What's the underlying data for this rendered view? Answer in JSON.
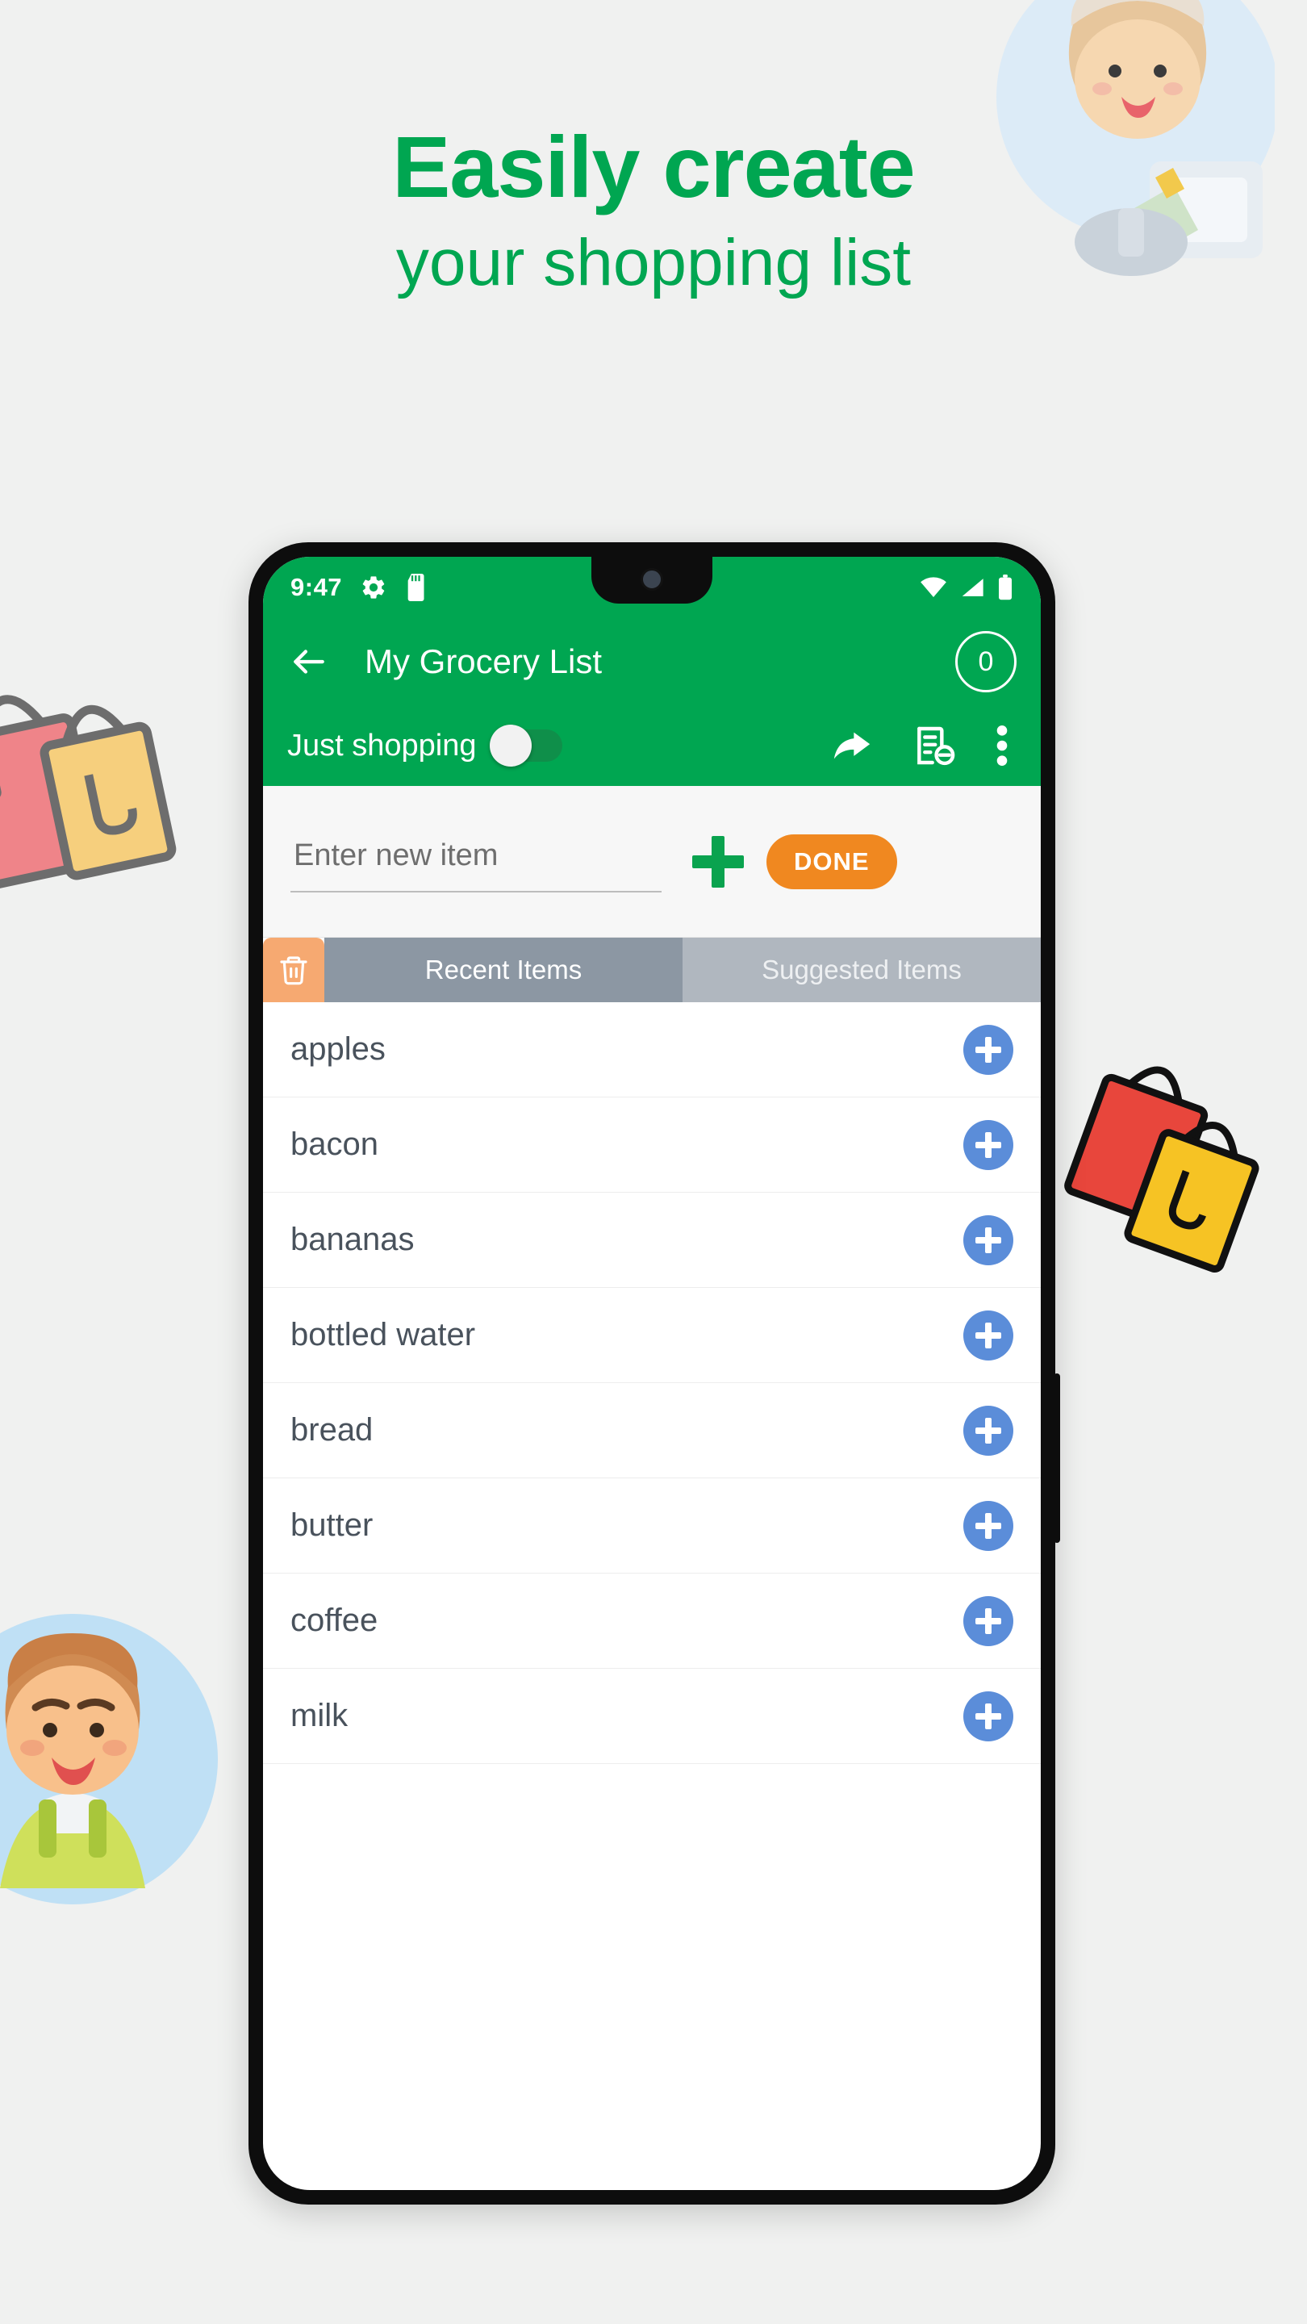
{
  "headline": {
    "line1": "Easily create",
    "line2": "your shopping list",
    "color": "#00a651"
  },
  "phone": {
    "statusbar": {
      "time": "9:47",
      "icons": [
        "gear-icon",
        "sd-card-icon"
      ],
      "right_icons": [
        "wifi-icon",
        "cellular-signal-icon",
        "battery-icon"
      ]
    },
    "appbar": {
      "back_icon": "back-arrow-icon",
      "title": "My Grocery List",
      "count": "0"
    },
    "toolbar": {
      "label": "Just shopping",
      "toggle_state": "off",
      "icons": [
        "share-icon",
        "list-remove-icon",
        "overflow-menu-icon"
      ]
    },
    "input_row": {
      "placeholder": "Enter new item",
      "value": "",
      "add_icon": "plus-icon",
      "done_label": "DONE",
      "done_color": "#f08820"
    },
    "tabs": {
      "trash_icon": "trash-icon",
      "trash_color": "#f6a971",
      "items": [
        {
          "label": "Recent Items",
          "active": true
        },
        {
          "label": "Suggested Items",
          "active": false
        }
      ]
    },
    "list": {
      "add_button_color": "#5b8dd9",
      "items": [
        {
          "label": "apples"
        },
        {
          "label": "bacon"
        },
        {
          "label": "bananas"
        },
        {
          "label": "bottled water"
        },
        {
          "label": "bread"
        },
        {
          "label": "butter"
        },
        {
          "label": "coffee"
        },
        {
          "label": "milk"
        }
      ]
    }
  }
}
